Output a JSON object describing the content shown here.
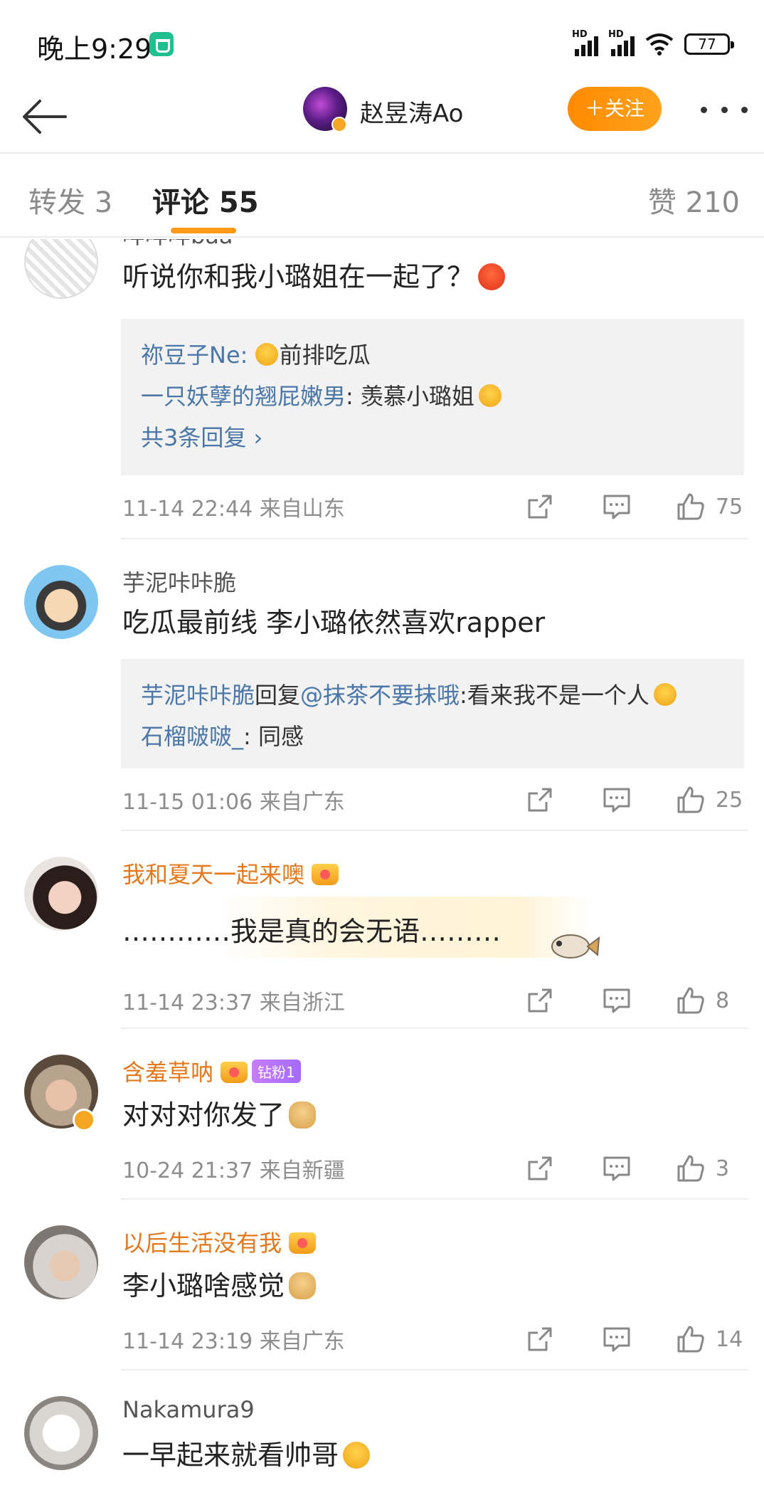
{
  "status_bar": {
    "time": "晚上9:29",
    "battery": "77",
    "signal_label": "HD"
  },
  "header": {
    "title": "赵昱涛Ao",
    "follow_label": "＋关注"
  },
  "tabs": {
    "repost": "转发 3",
    "comments": "评论 55",
    "likes": "赞 210"
  },
  "comments": [
    {
      "username": "咩咩咩baa",
      "text": "听说你和我小璐姐在一起了？",
      "replies": [
        {
          "user": "祢豆子Ne",
          "sep": ": ",
          "text": "前排吃瓜",
          "emoji_before": true
        },
        {
          "user": "一只妖孽的翘屁嫩男",
          "sep": ": ",
          "text": "羡慕小璐姐",
          "emoji_after": true
        }
      ],
      "more_replies": "共3条回复 ›",
      "meta": "11-14 22:44  来自山东",
      "likes": "75"
    },
    {
      "username": "芋泥咔咔脆",
      "text": "吃瓜最前线  李小璐依然喜欢rapper",
      "replies": [
        {
          "user": "芋泥咔咔脆",
          "mid": "回复",
          "mention": "@抹茶不要抹哦",
          "text": ":看来我不是一个人"
        },
        {
          "user": "石榴啵啵_",
          "sep": ": ",
          "text": "同感"
        }
      ],
      "meta": "11-15 01:06  来自广东",
      "likes": "25"
    },
    {
      "username": "我和夏天一起来噢",
      "text": "…………我是真的会无语………",
      "meta": "11-14 23:37  来自浙江",
      "likes": "8"
    },
    {
      "username": "含羞草呐",
      "fan_badge": "钻粉1",
      "text": "对对对你发了",
      "meta": "10-24 21:37  来自新疆",
      "likes": "3"
    },
    {
      "username": "以后生活没有我",
      "text": "李小璐啥感觉",
      "meta": "11-14 23:19  来自广东",
      "likes": "14"
    },
    {
      "username": "Nakamura9",
      "text": "一早起来就看帅哥",
      "meta": "",
      "likes": ""
    }
  ],
  "icons": [
    "back-arrow-icon",
    "more-icon",
    "share-icon",
    "comment-icon",
    "like-icon",
    "crown-icon",
    "verified-icon",
    "wifi-icon",
    "battery-icon"
  ],
  "colors": {
    "accent": "#ff9a16",
    "link": "#4a77a8",
    "vip_name": "#e4781b",
    "meta": "#8d8d8d"
  }
}
